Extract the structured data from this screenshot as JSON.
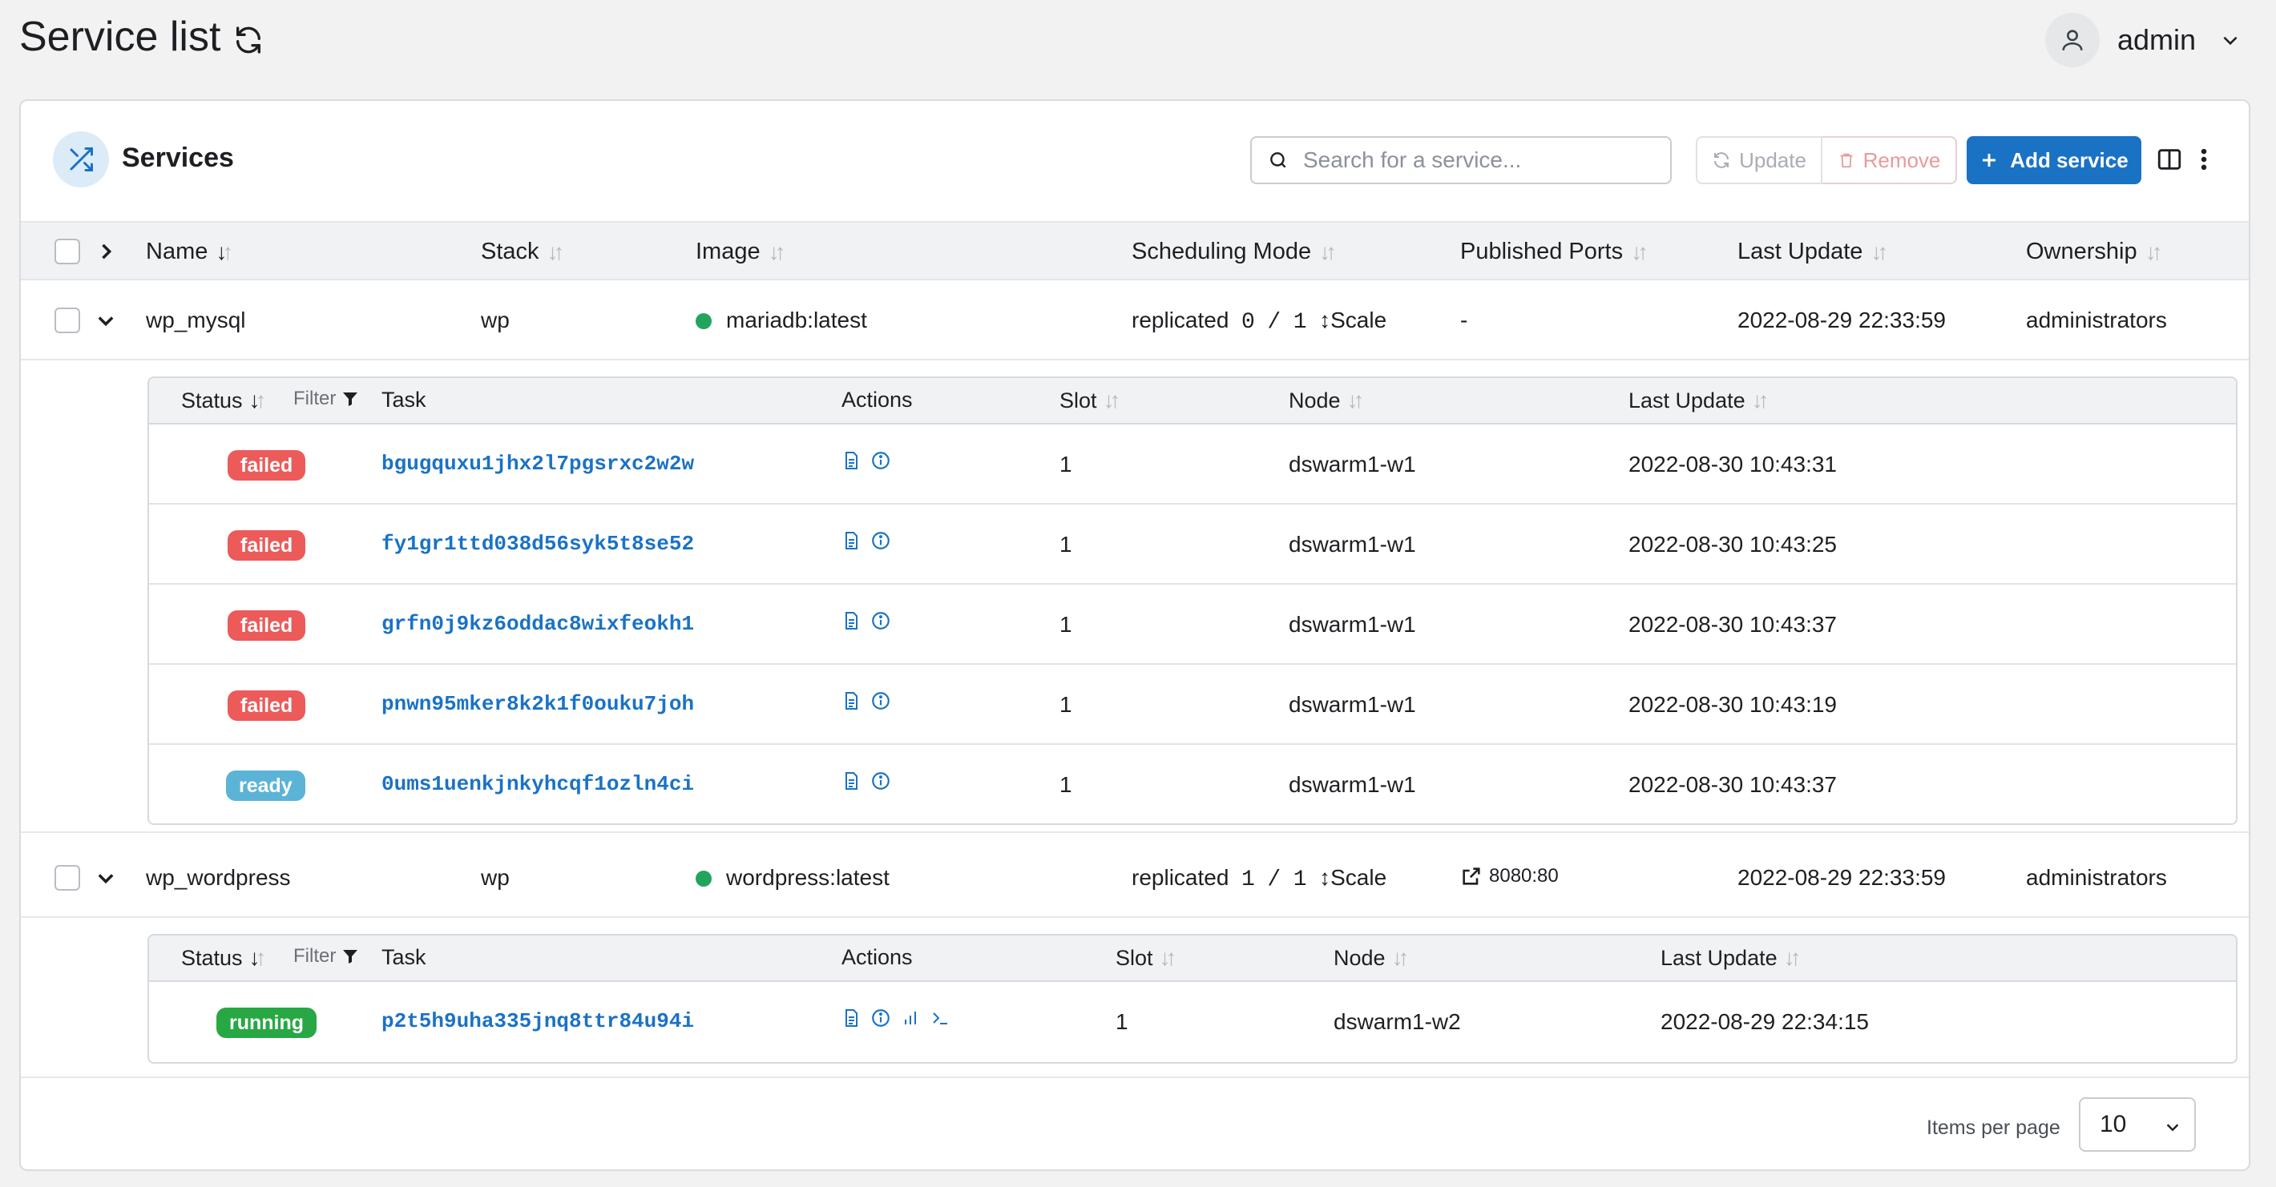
{
  "page": {
    "title": "Service list"
  },
  "user": {
    "name": "admin"
  },
  "panel": {
    "title": "Services",
    "search_placeholder": "Search for a service...",
    "update_label": "Update",
    "remove_label": "Remove",
    "add_label": "Add service"
  },
  "columns": {
    "name": "Name",
    "stack": "Stack",
    "image": "Image",
    "scheduling": "Scheduling Mode",
    "ports": "Published Ports",
    "last_update": "Last Update",
    "ownership": "Ownership"
  },
  "services": [
    {
      "name": "wp_mysql",
      "stack": "wp",
      "image": "mariadb:latest",
      "mode": "replicated",
      "running": "0",
      "sep": "/",
      "desired": "1",
      "scale": "Scale",
      "ports": "-",
      "last_update": "2022-08-29 22:33:59",
      "ownership": "administrators",
      "task_headers": {
        "status": "Status",
        "filter": "Filter",
        "task": "Task",
        "actions": "Actions",
        "slot": "Slot",
        "node": "Node",
        "last_update": "Last Update"
      },
      "tasks": [
        {
          "status": "failed",
          "id": "bgugquxu1jhx2l7pgsrxc2w2w",
          "slot": "1",
          "node": "dswarm1-w1",
          "updated": "2022-08-30 10:43:31"
        },
        {
          "status": "failed",
          "id": "fy1gr1ttd038d56syk5t8se52",
          "slot": "1",
          "node": "dswarm1-w1",
          "updated": "2022-08-30 10:43:25"
        },
        {
          "status": "failed",
          "id": "grfn0j9kz6oddac8wixfeokh1",
          "slot": "1",
          "node": "dswarm1-w1",
          "updated": "2022-08-30 10:43:37"
        },
        {
          "status": "failed",
          "id": "pnwn95mker8k2k1f0ouku7joh",
          "slot": "1",
          "node": "dswarm1-w1",
          "updated": "2022-08-30 10:43:19"
        },
        {
          "status": "ready",
          "id": "0ums1uenkjnkyhcqf1ozln4ci",
          "slot": "1",
          "node": "dswarm1-w1",
          "updated": "2022-08-30 10:43:37"
        }
      ]
    },
    {
      "name": "wp_wordpress",
      "stack": "wp",
      "image": "wordpress:latest",
      "mode": "replicated",
      "running": "1",
      "sep": "/",
      "desired": "1",
      "scale": "Scale",
      "ports": "8080:80",
      "last_update": "2022-08-29 22:33:59",
      "ownership": "administrators",
      "task_headers": {
        "status": "Status",
        "filter": "Filter",
        "task": "Task",
        "actions": "Actions",
        "slot": "Slot",
        "node": "Node",
        "last_update": "Last Update"
      },
      "tasks": [
        {
          "status": "running",
          "id": "p2t5h9uha335jnq8ttr84u94i",
          "slot": "1",
          "node": "dswarm1-w2",
          "updated": "2022-08-29 22:34:15"
        }
      ]
    }
  ],
  "footer": {
    "items_per_page_label": "Items per page",
    "items_per_page": "10"
  },
  "colors": {
    "primary": "#1a72c5",
    "failed": "#ec5a5a",
    "ready": "#5bb4d6",
    "running": "#27a844",
    "healthy_dot": "#22a45d"
  }
}
